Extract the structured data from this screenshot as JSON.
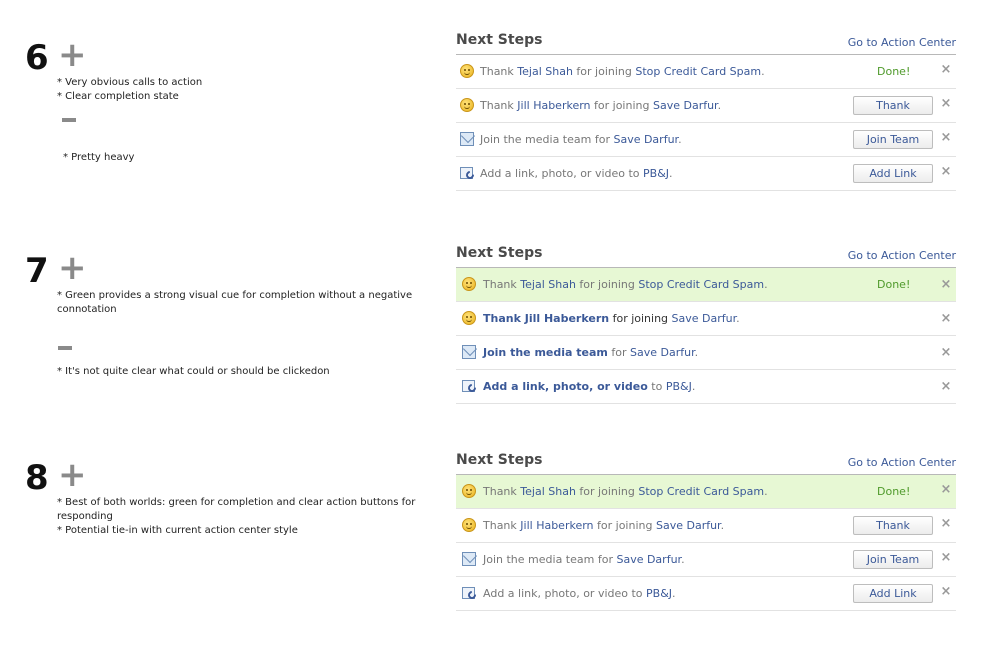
{
  "panel": {
    "title": "Next Steps",
    "action_link": "Go to Action Center"
  },
  "variants": [
    {
      "number": "6",
      "plus": "+",
      "pros": [
        "* Very obvious calls to action",
        "* Clear completion state"
      ],
      "cons": [
        "* Pretty heavy"
      ],
      "rows": [
        {
          "pre": "Thank ",
          "a": "Tejal Shah",
          "mid": " for joining ",
          "b": "Stop Credit Card Spam",
          "post": ".",
          "status": "Done!"
        },
        {
          "pre": "Thank ",
          "a": "Jill Haberkern",
          "mid": " for joining ",
          "b": "Save Darfur",
          "post": ".",
          "button": "Thank"
        },
        {
          "pre": "Join the media team for ",
          "b": "Save Darfur",
          "post": ".",
          "button": "Join Team"
        },
        {
          "pre": "Add a link, photo, or video to ",
          "b": "PB&J",
          "post": ".",
          "button": "Add Link"
        }
      ]
    },
    {
      "number": "7",
      "plus": "+",
      "pros": [
        "* Green provides a strong visual cue for completion without a negative",
        "connotation"
      ],
      "cons": [
        "* It's not quite clear what could or should be clickedon"
      ],
      "rows": [
        {
          "pre": "Thank ",
          "a": "Tejal Shah",
          "mid": " for joining ",
          "b": "Stop Credit Card Spam",
          "post": ".",
          "status": "Done!"
        },
        {
          "a": "Thank Jill Haberkern",
          "mid": " for joining ",
          "b": "Save Darfur",
          "post": "."
        },
        {
          "a": "Join the media team",
          "mid": " for ",
          "b": "Save Darfur",
          "post": "."
        },
        {
          "a": "Add a link, photo, or video",
          "mid": " to ",
          "b": "PB&J",
          "post": "."
        }
      ]
    },
    {
      "number": "8",
      "plus": "+",
      "pros": [
        "* Best of both worlds: green for completion and clear action buttons for responding",
        "* Potential  tie-in with current action center style"
      ],
      "rows": [
        {
          "pre": "Thank ",
          "a": "Tejal Shah",
          "mid": " for joining ",
          "b": "Stop Credit Card Spam",
          "post": ".",
          "status": "Done!"
        },
        {
          "pre": "Thank ",
          "a": "Jill Haberkern",
          "mid": " for joining ",
          "b": "Save Darfur",
          "post": ".",
          "button": "Thank"
        },
        {
          "pre": "Join the media team for ",
          "b": "Save Darfur",
          "post": ".",
          "button": "Join Team"
        },
        {
          "pre": "Add a link, photo, or video to ",
          "b": "PB&J",
          "post": ".",
          "button": "Add Link"
        }
      ]
    }
  ],
  "close_glyph": "×",
  "colors": {
    "link": "#3b5998",
    "done": "#4f9a2b",
    "done_bg": "#e7f8d4",
    "accent_gray": "#8a8a8a"
  },
  "icons": [
    "smiley-icon",
    "envelope-icon",
    "link-share-icon",
    "close-icon"
  ]
}
